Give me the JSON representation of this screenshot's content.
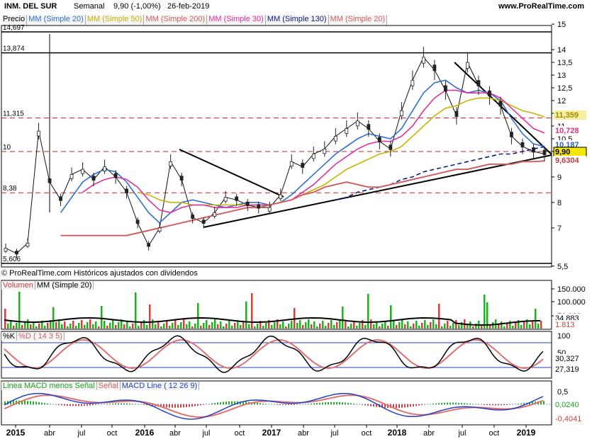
{
  "header": {
    "instrument": "INM. DEL SUR",
    "period": "Semanal",
    "quote": "9,90 (-1,00%)",
    "date": "26-feb-2019",
    "site": "www.ProRealTime.com"
  },
  "legend": {
    "precio": "Precio",
    "ma20": "MM (Simple 20)",
    "ma50": "MM (Simple 50)",
    "ma200": "MM (Simple 200)",
    "ma30": "MM (Simple 30)",
    "ma130": "MM (Simple 130)",
    "ma20b": "MM (Simple 20)"
  },
  "attribution": "© ProRealTime.com  Históricos ajustados con dividendos",
  "price_panel": {
    "left_levels": [
      "14,697",
      "13,874",
      "11,315",
      "10",
      "8,38",
      "5,606"
    ],
    "right_ticks": [
      "15",
      "14",
      "13,5",
      "13",
      "12,5",
      "12",
      "11,5",
      "11",
      "10,5",
      "10",
      "9",
      "8",
      "7",
      "5,5"
    ],
    "tags": [
      {
        "text": "11,359",
        "bg": "#f5f0a0",
        "fg": "#a08a00"
      },
      {
        "text": "10,728",
        "bg": "#ffffff",
        "fg": "#e0307f"
      },
      {
        "text": "10,187",
        "bg": "#ffffff",
        "fg": "#3060c0"
      },
      {
        "text": "9,90",
        "bg": "#f5e800",
        "fg": "#000000"
      },
      {
        "text": "9,6304",
        "bg": "#ffffff",
        "fg": "#c04040"
      }
    ]
  },
  "volume_panel": {
    "legend_a": "Volumen",
    "legend_b": "MM (Simple 20)",
    "ticks": [
      "150.000",
      "100.000",
      "50.000"
    ],
    "tags": [
      "34.883",
      "1.813"
    ]
  },
  "stoch_panel": {
    "legend_a": "%K",
    "legend_b": "%D ( 14 3 5)",
    "ticks": [
      "100",
      "50"
    ],
    "tags": [
      "30,327",
      "27,319"
    ]
  },
  "macd_panel": {
    "legend_a": "Linea MACD menos Señal",
    "legend_b": "Señal",
    "legend_c": "MACD Line ( 12 26 9)",
    "ticks": [
      "0,5"
    ],
    "tags": [
      "0,0240",
      "-0,4041"
    ]
  },
  "x_axis": [
    "2015",
    "abr",
    "jul",
    "oct",
    "2016",
    "abr",
    "jul",
    "oct",
    "2017",
    "abr",
    "jul",
    "oct",
    "2018",
    "abr",
    "jul",
    "oct",
    "2019"
  ],
  "chart_data": {
    "type": "line",
    "title": "INM. DEL SUR",
    "x": [
      "2015-01",
      "2015-02",
      "2015-03",
      "2015-04",
      "2015-05",
      "2015-06",
      "2015-07",
      "2015-08",
      "2015-09",
      "2015-10",
      "2015-11",
      "2015-12",
      "2016-01",
      "2016-02",
      "2016-03",
      "2016-04",
      "2016-05",
      "2016-06",
      "2016-07",
      "2016-08",
      "2016-09",
      "2016-10",
      "2016-11",
      "2016-12",
      "2017-01",
      "2017-02",
      "2017-03",
      "2017-04",
      "2017-05",
      "2017-06",
      "2017-07",
      "2017-08",
      "2017-09",
      "2017-10",
      "2017-11",
      "2017-12",
      "2018-01",
      "2018-02",
      "2018-03",
      "2018-04",
      "2018-05",
      "2018-06",
      "2018-07",
      "2018-08",
      "2018-09",
      "2018-10",
      "2018-11",
      "2018-12",
      "2019-01",
      "2019-02"
    ],
    "series": [
      {
        "name": "Precio",
        "values": [
          6.2,
          6.0,
          6.4,
          10.8,
          8.8,
          8.1,
          9.1,
          9.3,
          8.9,
          9.4,
          9.0,
          8.4,
          7.2,
          6.3,
          7.0,
          9.6,
          8.9,
          7.4,
          7.2,
          7.6,
          8.2,
          8.1,
          7.9,
          7.8,
          7.8,
          8.3,
          9.6,
          9.4,
          9.9,
          10.1,
          10.6,
          10.9,
          11.2,
          10.9,
          10.4,
          10.1,
          11.6,
          12.8,
          13.7,
          13.2,
          12.4,
          11.4,
          13.5,
          12.6,
          12.2,
          11.8,
          10.6,
          10.2,
          10.0,
          9.9
        ]
      },
      {
        "name": "MM (Simple 20)",
        "values": [
          null,
          null,
          null,
          null,
          null,
          7.6,
          8.2,
          8.8,
          9.1,
          9.3,
          9.2,
          8.8,
          8.2,
          7.6,
          7.2,
          7.6,
          8.0,
          8.1,
          8.0,
          7.9,
          7.8,
          7.9,
          8.0,
          8.0,
          7.9,
          8.0,
          8.3,
          8.7,
          9.1,
          9.5,
          9.9,
          10.2,
          10.5,
          10.7,
          10.6,
          10.5,
          10.9,
          11.6,
          12.3,
          12.7,
          12.8,
          12.5,
          12.3,
          12.4,
          12.3,
          12.0,
          11.3,
          10.7,
          10.3,
          10.2
        ]
      },
      {
        "name": "MM (Simple 50)",
        "values": [
          null,
          null,
          null,
          null,
          null,
          null,
          null,
          null,
          null,
          null,
          null,
          null,
          8.4,
          8.3,
          8.1,
          8.0,
          8.0,
          7.9,
          7.9,
          7.9,
          7.9,
          7.9,
          7.9,
          7.9,
          7.9,
          8.0,
          8.1,
          8.3,
          8.5,
          8.7,
          9.0,
          9.3,
          9.5,
          9.7,
          9.9,
          10.0,
          10.2,
          10.6,
          11.0,
          11.4,
          11.7,
          11.8,
          12.0,
          12.1,
          12.1,
          12.0,
          11.8,
          11.6,
          11.5,
          11.36
        ]
      },
      {
        "name": "MM (Simple 30)",
        "values": [
          null,
          null,
          null,
          null,
          null,
          null,
          null,
          8.4,
          8.7,
          8.9,
          9.0,
          8.9,
          8.6,
          8.1,
          7.7,
          7.6,
          7.8,
          7.9,
          7.9,
          7.8,
          7.8,
          7.8,
          7.9,
          7.9,
          7.9,
          8.0,
          8.1,
          8.4,
          8.7,
          9.1,
          9.5,
          9.8,
          10.1,
          10.3,
          10.4,
          10.4,
          10.6,
          11.0,
          11.6,
          12.1,
          12.4,
          12.4,
          12.3,
          12.3,
          12.3,
          12.1,
          11.7,
          11.3,
          10.9,
          10.73
        ]
      },
      {
        "name": "MM (Simple 130)",
        "values": [
          null,
          null,
          null,
          null,
          null,
          null,
          null,
          null,
          null,
          null,
          null,
          null,
          null,
          null,
          null,
          null,
          null,
          null,
          null,
          null,
          null,
          null,
          null,
          null,
          null,
          null,
          null,
          null,
          null,
          null,
          8.1,
          8.2,
          8.4,
          8.5,
          8.6,
          8.7,
          8.9,
          9.0,
          9.2,
          9.3,
          9.4,
          9.5,
          9.6,
          9.7,
          9.8,
          9.9,
          9.9,
          10.0,
          10.1,
          10.19
        ]
      },
      {
        "name": "MM (Simple 200)",
        "values": [
          null,
          null,
          null,
          null,
          null,
          6.7,
          6.7,
          6.7,
          6.7,
          6.7,
          6.7,
          6.7,
          6.8,
          6.9,
          7.0,
          7.1,
          7.2,
          7.3,
          7.4,
          7.5,
          7.6,
          7.7,
          7.8,
          7.8,
          7.9,
          8.0,
          8.1,
          8.3,
          8.4,
          8.6,
          8.7,
          8.8,
          8.7,
          8.6,
          8.6,
          8.7,
          8.8,
          8.9,
          9.0,
          9.1,
          9.2,
          9.3,
          9.3,
          9.4,
          9.5,
          9.5,
          9.5,
          9.6,
          9.6,
          9.63
        ]
      }
    ],
    "ylim": [
      5.5,
      15
    ]
  }
}
